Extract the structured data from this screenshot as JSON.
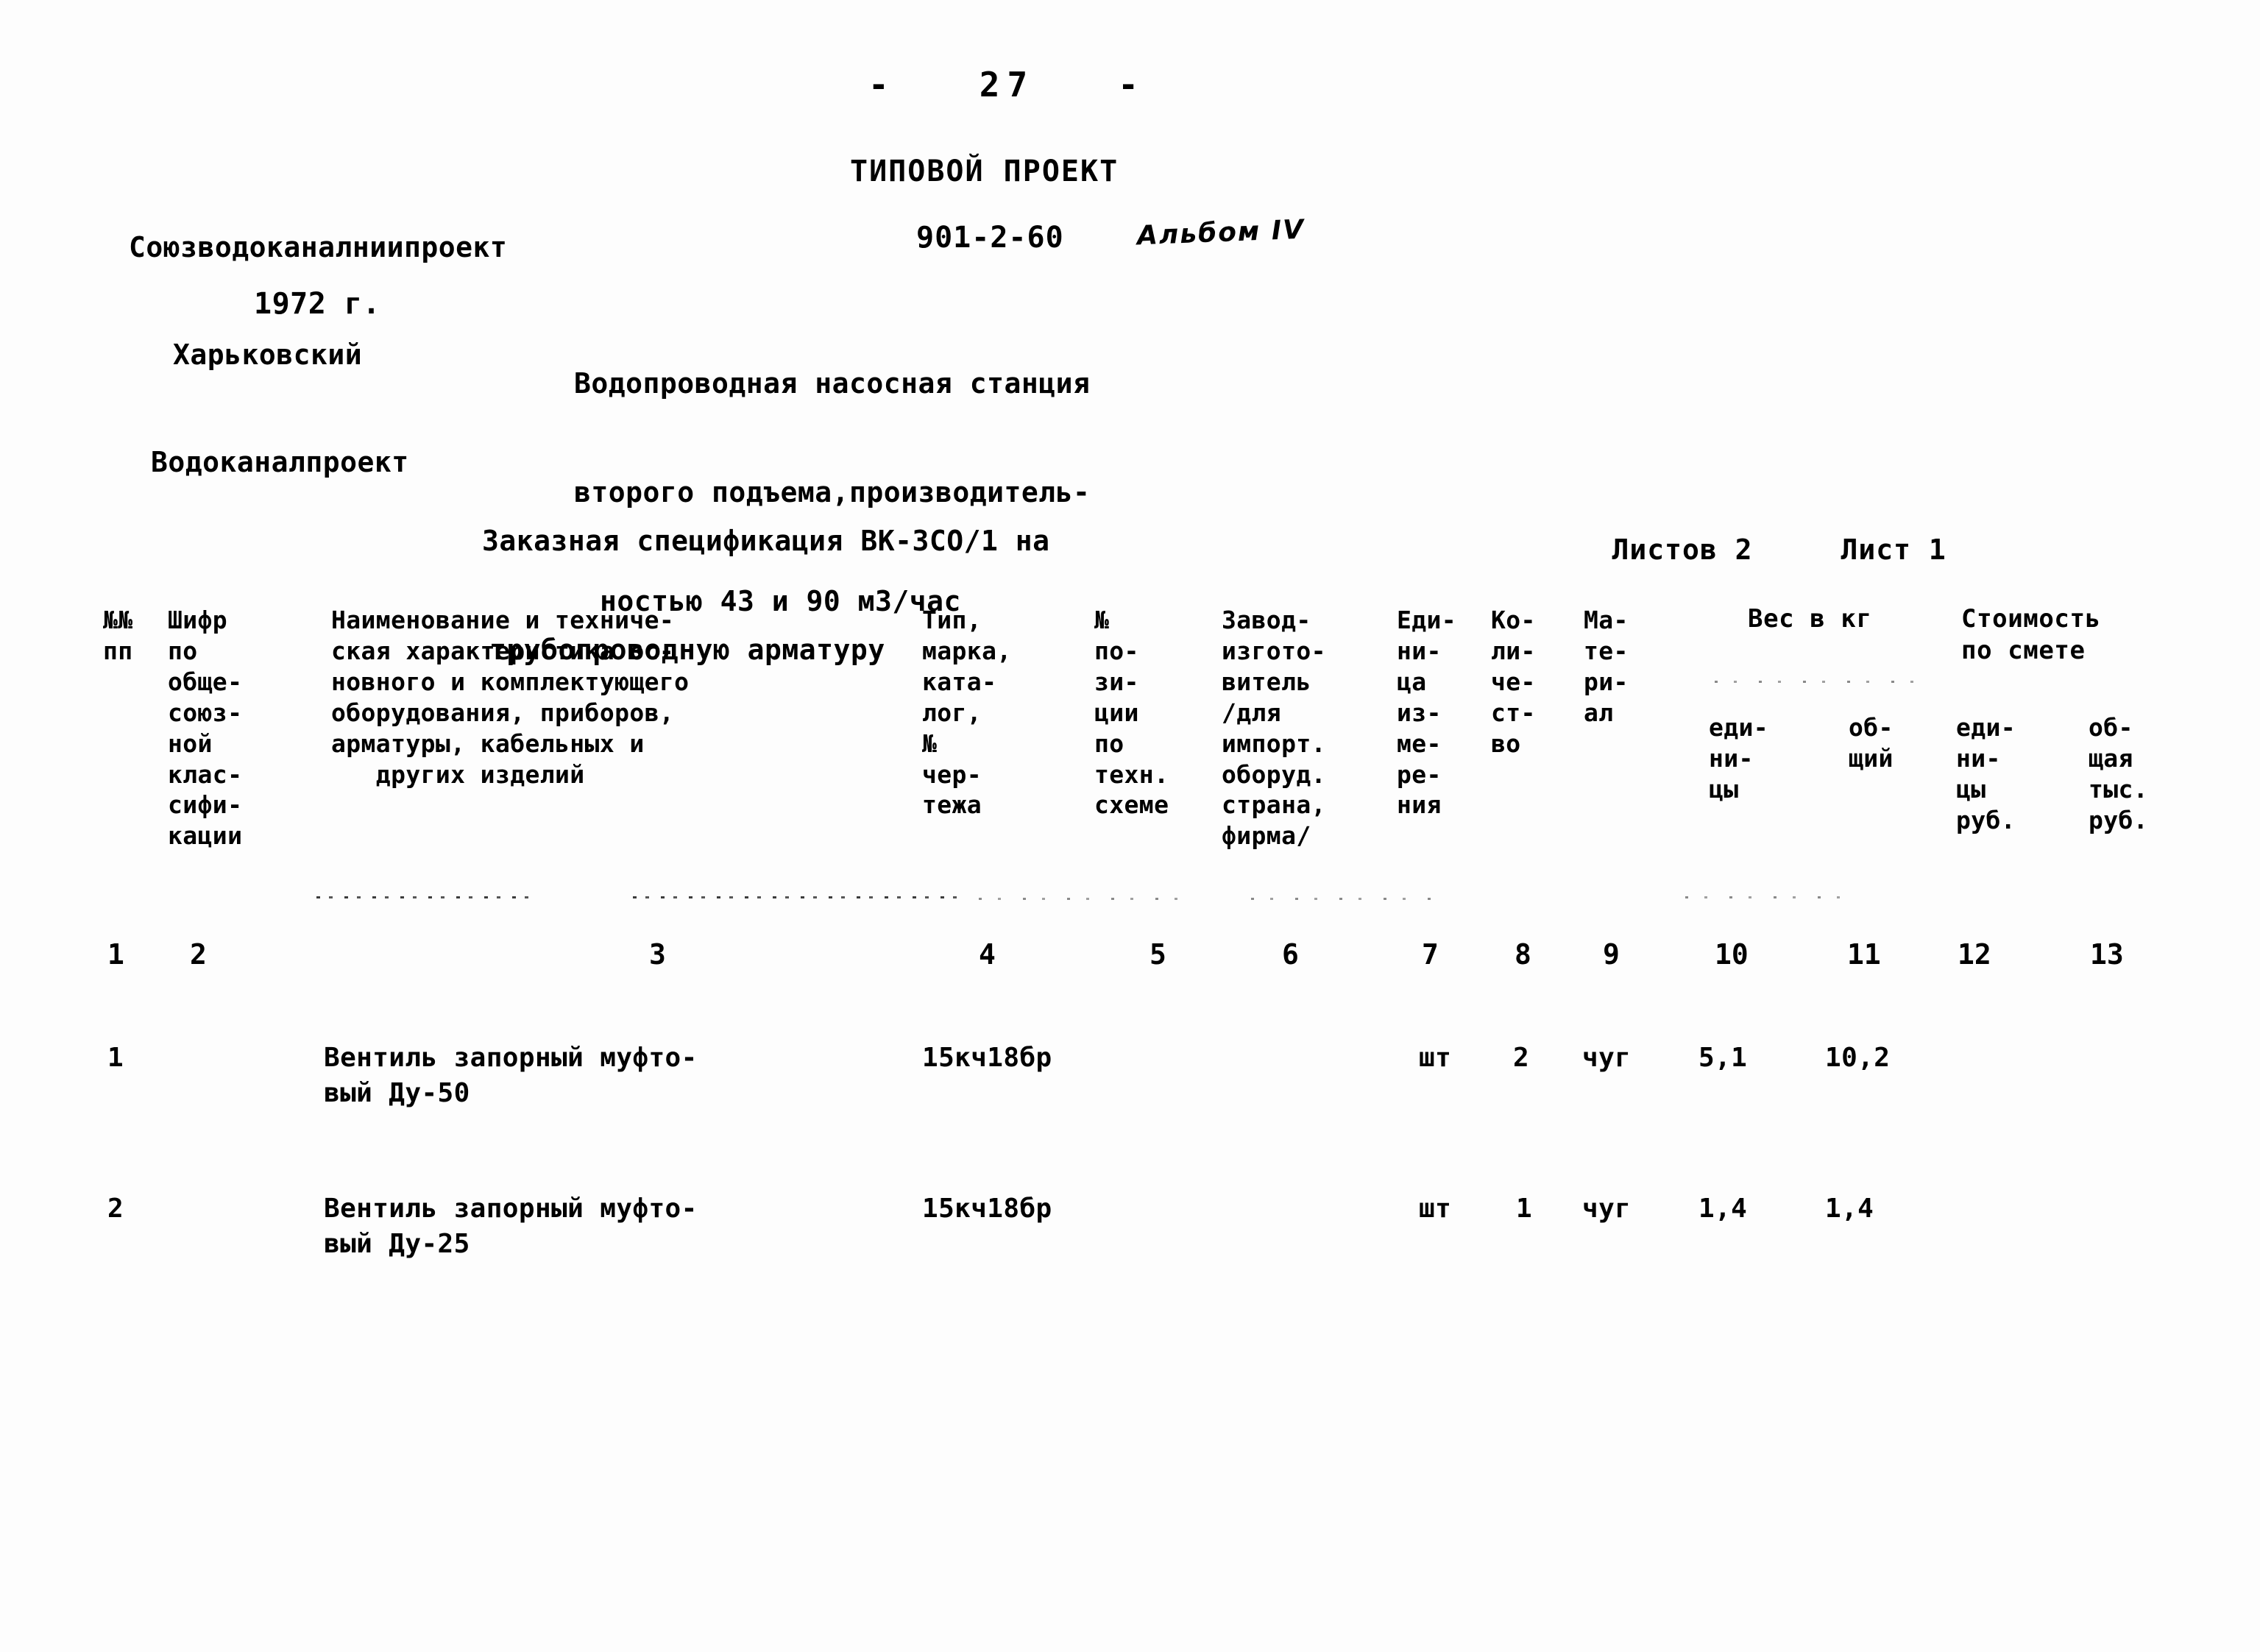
{
  "page": {
    "number_line": "-   27   -"
  },
  "organisation": {
    "line1": "Союзводоканалниипроект",
    "line2": "Харьковский",
    "line3": "Водоканалпроект",
    "year": "1972 г."
  },
  "project": {
    "kind": "ТИПОВОЙ ПРОЕКТ",
    "code": "901-2-60",
    "album_note": "Альбом IV",
    "description_line1": "Водопроводная насосная станция",
    "description_line2": "второго подъема,производитель-",
    "description_line3": "ностью 43 и 90 м3/час"
  },
  "specification": {
    "caption_line1": "Заказная спецификация ВК-3СО/1 на",
    "caption_line2": "трубопроводную арматуру",
    "sheets_total_label": "Листов 2",
    "sheet_current_label": "Лист 1"
  },
  "table": {
    "group_headers": [
      {
        "label": "Вес в кг"
      },
      {
        "label": "Стоимость\nпо смете"
      }
    ],
    "headers": [
      {
        "n": "1",
        "label": "№№\nпп"
      },
      {
        "n": "2",
        "label": "Шифр\nпо\nобще-\nсоюз-\nной\nклас-\nсифи-\nкации"
      },
      {
        "n": "3",
        "label": "Наименование и техниче-\nская характеристика ос-\nновного и комплектующего\nоборудования, приборов,\nарматуры, кабельных и\n   других изделий"
      },
      {
        "n": "4",
        "label": "Тип,\nмарка,\nката-\nлог,\n№\nчер-\nтежа"
      },
      {
        "n": "5",
        "label": "№\nпо-\nзи-\nции\nпо\nтехн.\nсхеме"
      },
      {
        "n": "6",
        "label": "Завод-\nизгото-\nвитель\n/для\nимпорт.\nоборуд.\nстрана,\nфирма/"
      },
      {
        "n": "7",
        "label": "Еди-\nни-\nца\nиз-\nме-\nре-\nния"
      },
      {
        "n": "8",
        "label": "Ко-\nли-\nче-\nст-\nво"
      },
      {
        "n": "9",
        "label": "Ма-\nте-\nри-\nал"
      },
      {
        "n": "10",
        "label": "еди-\nни-\nцы"
      },
      {
        "n": "11",
        "label": "об-\nщий"
      },
      {
        "n": "12",
        "label": "еди-\nни-\nцы\nруб."
      },
      {
        "n": "13",
        "label": "об-\nщая\nтыс.\nруб."
      }
    ],
    "rows": [
      {
        "num": "1",
        "code": "",
        "name_line1": "Вентиль запорный муфто-",
        "name_line2": "вый Ду-50",
        "type": "15кч18бр",
        "position": "",
        "manufacturer": "",
        "unit": "шт",
        "qty": "2",
        "material": "чуг",
        "weight_unit": "5,1",
        "weight_total": "10,2",
        "cost_unit": "",
        "cost_total": ""
      },
      {
        "num": "2",
        "code": "",
        "name_line1": "Вентиль запорный муфто-",
        "name_line2": "вый Ду-25",
        "type": "15кч18бр",
        "position": "",
        "manufacturer": "",
        "unit": "шт",
        "qty": "1",
        "material": "чуг",
        "weight_unit": "1,4",
        "weight_total": "1,4",
        "cost_unit": "",
        "cost_total": ""
      }
    ]
  },
  "colors": {
    "ink": "#000000",
    "paper": "#fdfdfd"
  }
}
